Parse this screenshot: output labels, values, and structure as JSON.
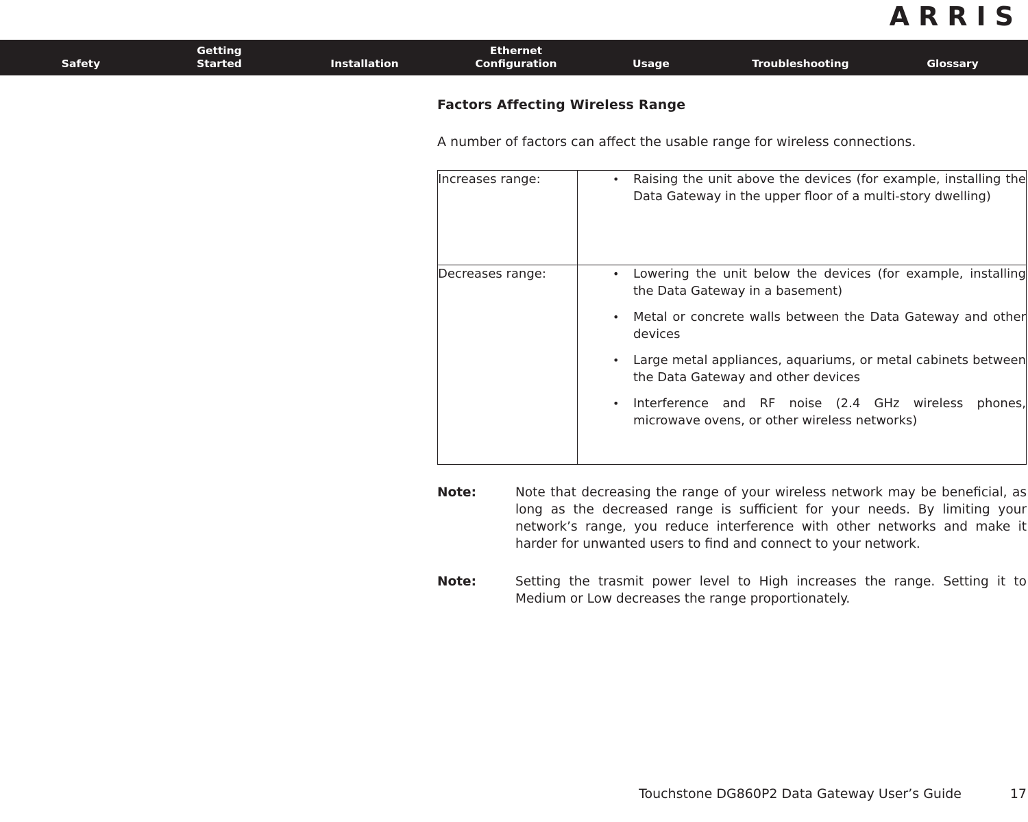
{
  "brand": {
    "logo_text": "ARRIS"
  },
  "nav": {
    "items": [
      {
        "id": "safety",
        "label": "Safety"
      },
      {
        "id": "getting",
        "label": "Getting\nStarted"
      },
      {
        "id": "installation",
        "label": "Installation"
      },
      {
        "id": "ethernet",
        "label": "Ethernet\nConfiguration"
      },
      {
        "id": "usage",
        "label": "Usage"
      },
      {
        "id": "trouble",
        "label": "Troubleshooting"
      },
      {
        "id": "glossary",
        "label": "Glossary"
      }
    ]
  },
  "main": {
    "title": "Factors Affecting Wireless Range",
    "intro": "A number of factors can affect the usable range for wireless connections.",
    "table": {
      "rows": [
        {
          "label": "Increases range:",
          "items": [
            "Raising the unit above the devices (for example, installing the Data Gateway in the upper floor of a multi-story dwelling)"
          ]
        },
        {
          "label": "Decreases range:",
          "items": [
            "Lowering the unit below the devices (for example, installing the Data Gateway in a basement)",
            "Metal or concrete walls between the Data Gateway and other devices",
            "Large metal appliances, aquariums, or metal cabinets between the Data Gateway and other devices",
            "Interference and RF noise (2.4 GHz wireless phones, microwave ovens, or other wireless networks)"
          ]
        }
      ]
    },
    "notes": [
      {
        "label": "Note:",
        "text": "Note that decreasing the range of your wireless network may be beneficial, as long as the decreased range is sufficient for your needs. By limiting your network’s range, you reduce interference with other networks and make it harder for unwanted users to find and connect to your network."
      },
      {
        "label": "Note:",
        "text": "Setting the trasmit power level to High increases the range.  Setting it to Medium or Low decreases the range proportionately."
      }
    ]
  },
  "footer": {
    "title": "Touchstone DG860P2 Data Gateway User’s Guide",
    "page": "17"
  },
  "colors": {
    "ink": "#231f20",
    "nav_background": "#231f20",
    "nav_text": "#ffffff",
    "page_background": "#ffffff"
  }
}
